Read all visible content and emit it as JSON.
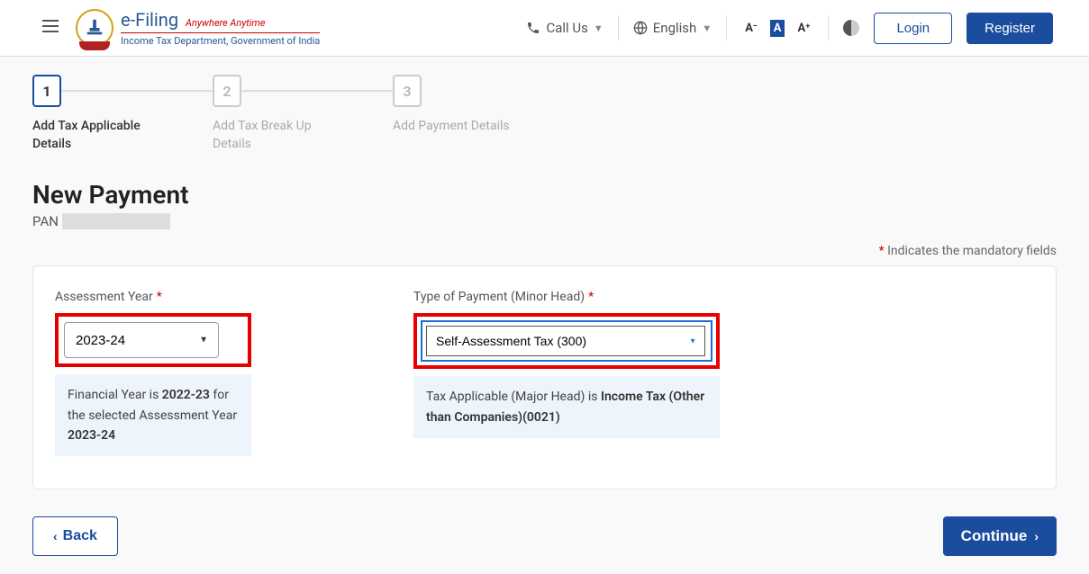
{
  "header": {
    "brand_title": "e-Filing",
    "brand_tagline": "Anywhere Anytime",
    "brand_dept": "Income Tax Department, Government of India",
    "call_us": "Call Us",
    "language": "English",
    "font_small": "A⁻",
    "font_normal": "A",
    "font_large": "A⁺",
    "login": "Login",
    "register": "Register"
  },
  "stepper": {
    "steps": [
      {
        "num": "1",
        "label": "Add Tax Applicable Details"
      },
      {
        "num": "2",
        "label": "Add Tax Break Up Details"
      },
      {
        "num": "3",
        "label": "Add Payment Details"
      }
    ]
  },
  "page": {
    "title": "New Payment",
    "pan_label": "PAN",
    "mandatory_note": "Indicates the mandatory fields"
  },
  "form": {
    "ay_label": "Assessment Year",
    "ay_value": "2023-24",
    "ay_hint_prefix": "Financial Year is ",
    "ay_hint_fy": "2022-23",
    "ay_hint_mid": " for the selected Assessment Year ",
    "ay_hint_ay": "2023-24",
    "pay_label": "Type of Payment (Minor Head)",
    "pay_value": "Self-Assessment Tax (300)",
    "pay_hint_prefix": "Tax Applicable (Major Head) is ",
    "pay_hint_bold": "Income Tax (Other than Companies)(0021)"
  },
  "footer": {
    "back": "Back",
    "continue": "Continue"
  }
}
